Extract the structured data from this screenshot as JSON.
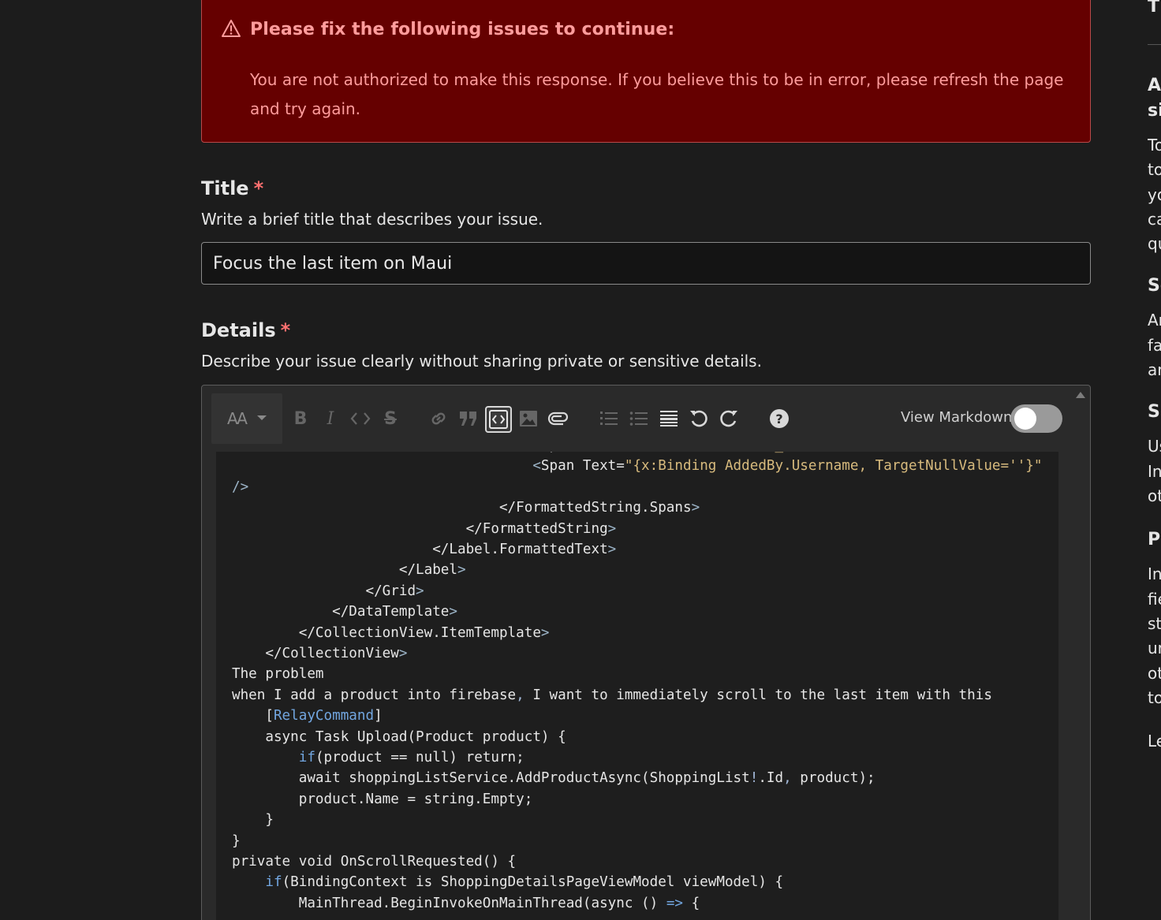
{
  "alert": {
    "title": "Please fix the following issues to continue:",
    "message": "You are not authorized to make this response. If you believe this to be in error, please refresh the page and try again."
  },
  "title_field": {
    "label": "Title",
    "required_mark": "*",
    "hint": "Write a brief title that describes your issue.",
    "value": "Focus the last item on Maui"
  },
  "details_field": {
    "label": "Details",
    "required_mark": "*",
    "hint": "Describe your issue clearly without sharing private or sensitive details."
  },
  "editor": {
    "toolbar": {
      "heading_label": "AA",
      "view_markdown_label": "View Markdown",
      "view_markdown_on": false
    },
    "code_lines": [
      {
        "segments": [
          {
            "t": "                                    "
          },
          {
            "t": "<",
            "c": "tag"
          },
          {
            "t": "Span Text="
          },
          {
            "t": "\"{loc:Translate UI_Added}\"",
            "c": "str"
          },
          {
            "t": " />",
            "c": "tag"
          }
        ]
      },
      {
        "segments": [
          {
            "t": "                                    "
          },
          {
            "t": "<",
            "c": "tag"
          },
          {
            "t": "Span Text="
          },
          {
            "t": "\"{x:Binding AddedBy.Username, TargetNullValue=''}\"",
            "c": "str"
          }
        ]
      },
      {
        "segments": [
          {
            "t": "/>",
            "c": "tag"
          }
        ]
      },
      {
        "segments": [
          {
            "t": "                                </FormattedString.Spans"
          },
          {
            "t": ">",
            "c": "tag"
          }
        ]
      },
      {
        "segments": [
          {
            "t": "                            </FormattedString"
          },
          {
            "t": ">",
            "c": "tag"
          }
        ]
      },
      {
        "segments": [
          {
            "t": "                        </Label.FormattedText"
          },
          {
            "t": ">",
            "c": "tag"
          }
        ]
      },
      {
        "segments": [
          {
            "t": "                    </Label"
          },
          {
            "t": ">",
            "c": "tag"
          }
        ]
      },
      {
        "segments": [
          {
            "t": "                </Grid"
          },
          {
            "t": ">",
            "c": "tag"
          }
        ]
      },
      {
        "segments": [
          {
            "t": "            </DataTemplate"
          },
          {
            "t": ">",
            "c": "tag"
          }
        ]
      },
      {
        "segments": [
          {
            "t": "        </CollectionView.ItemTemplate"
          },
          {
            "t": ">",
            "c": "tag"
          }
        ]
      },
      {
        "segments": [
          {
            "t": "    </CollectionView"
          },
          {
            "t": ">",
            "c": "tag"
          }
        ]
      },
      {
        "segments": [
          {
            "t": "The problem"
          }
        ]
      },
      {
        "segments": [
          {
            "t": "when I add a product into firebase"
          },
          {
            "t": ",",
            "c": "op"
          },
          {
            "t": " I want to immediately scroll to the last item with this"
          }
        ]
      },
      {
        "segments": [
          {
            "t": "    ["
          },
          {
            "t": "RelayCommand",
            "c": "kw"
          },
          {
            "t": "]"
          }
        ]
      },
      {
        "segments": [
          {
            "t": "    async Task Upload(Product product) {"
          }
        ]
      },
      {
        "segments": [
          {
            "t": "        "
          },
          {
            "t": "if",
            "c": "kw"
          },
          {
            "t": "(product == null) return;"
          }
        ]
      },
      {
        "segments": [
          {
            "t": "        await shoppingListService.AddProductAsync(ShoppingList"
          },
          {
            "t": "!",
            "c": "op"
          },
          {
            "t": ".Id"
          },
          {
            "t": ",",
            "c": "op"
          },
          {
            "t": " product);"
          }
        ]
      },
      {
        "segments": [
          {
            "t": "        product.Name = string.Empty;"
          }
        ]
      },
      {
        "segments": [
          {
            "t": "    }"
          }
        ]
      },
      {
        "segments": [
          {
            "t": "}"
          }
        ]
      },
      {
        "segments": [
          {
            "t": "private void OnScrollRequested() {"
          }
        ]
      },
      {
        "segments": [
          {
            "t": "    "
          },
          {
            "t": "if",
            "c": "kw"
          },
          {
            "t": "(BindingContext is ShoppingDetailsPageViewModel viewModel) {"
          }
        ]
      },
      {
        "segments": [
          {
            "t": "        MainThread.BeginInvokeOnMainThread(async () "
          },
          {
            "t": "=>",
            "c": "kw"
          },
          {
            "t": " {"
          }
        ]
      }
    ]
  },
  "sidebar": {
    "items": [
      {
        "text": "T",
        "heading": true
      },
      {
        "text": "A",
        "heading": true
      },
      {
        "text": "si",
        "heading": true
      },
      {
        "text": "To"
      },
      {
        "text": "to"
      },
      {
        "text": "yo"
      },
      {
        "text": "ca"
      },
      {
        "text": "qu"
      },
      {
        "text": "Se",
        "heading": true
      },
      {
        "text": "Ar"
      },
      {
        "text": "fa"
      },
      {
        "text": "ar"
      },
      {
        "text": "Su",
        "heading": true
      },
      {
        "text": "Us"
      },
      {
        "text": "In"
      },
      {
        "text": "ot"
      },
      {
        "text": "Pr",
        "heading": true
      },
      {
        "text": "In"
      },
      {
        "text": "fie"
      },
      {
        "text": "st"
      },
      {
        "text": "ur"
      },
      {
        "text": "ot"
      },
      {
        "text": "to"
      },
      {
        "text": "Le"
      }
    ]
  }
}
